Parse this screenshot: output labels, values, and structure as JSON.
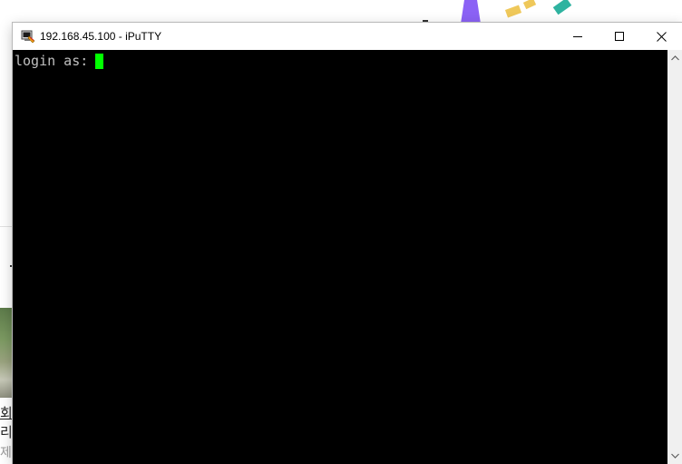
{
  "window": {
    "title": "192.168.45.100 - iPuTTY",
    "app_icon": "putty-icon",
    "controls": {
      "minimize_icon": "minimize-icon",
      "maximize_icon": "maximize-icon",
      "close_icon": "close-icon"
    }
  },
  "terminal": {
    "prompt": "login as:",
    "cursor_color": "#00ff00",
    "background_color": "#000000",
    "text_color": "#c0c0c0"
  },
  "scrollbar": {
    "up_icon": "scroll-up-arrow-icon",
    "down_icon": "scroll-down-arrow-icon"
  },
  "background": {
    "text_fragments": [
      "회",
      "리",
      "제"
    ]
  }
}
